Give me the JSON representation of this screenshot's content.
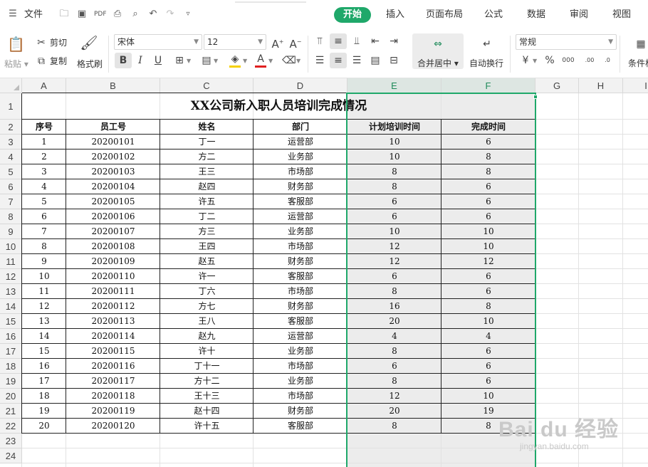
{
  "menu": {
    "file": "文件",
    "tabs": [
      "开始",
      "插入",
      "页面布局",
      "公式",
      "数据",
      "审阅",
      "视图"
    ]
  },
  "ribbon": {
    "paste": "粘贴",
    "cut": "剪切",
    "copy": "复制",
    "format_painter": "格式刷",
    "font_name": "宋体",
    "font_size": "12",
    "merge_center": "合并居中",
    "wrap_text": "自动换行",
    "number_format": "常规",
    "conditional_format": "条件格"
  },
  "sheet": {
    "columns": [
      "A",
      "B",
      "C",
      "D",
      "E",
      "F",
      "G",
      "H",
      "I"
    ],
    "title": "XX公司新入职人员培训完成情况",
    "headers": [
      "序号",
      "员工号",
      "姓名",
      "部门",
      "计划培训时间",
      "完成时间"
    ],
    "rows": [
      [
        "1",
        "20200101",
        "丁一",
        "运营部",
        "10",
        "6"
      ],
      [
        "2",
        "20200102",
        "方二",
        "业务部",
        "10",
        "8"
      ],
      [
        "3",
        "20200103",
        "王三",
        "市场部",
        "8",
        "8"
      ],
      [
        "4",
        "20200104",
        "赵四",
        "财务部",
        "8",
        "6"
      ],
      [
        "5",
        "20200105",
        "许五",
        "客服部",
        "6",
        "6"
      ],
      [
        "6",
        "20200106",
        "丁二",
        "运营部",
        "6",
        "6"
      ],
      [
        "7",
        "20200107",
        "方三",
        "业务部",
        "10",
        "10"
      ],
      [
        "8",
        "20200108",
        "王四",
        "市场部",
        "12",
        "10"
      ],
      [
        "9",
        "20200109",
        "赵五",
        "财务部",
        "12",
        "12"
      ],
      [
        "10",
        "20200110",
        "许一",
        "客服部",
        "6",
        "6"
      ],
      [
        "11",
        "20200111",
        "丁六",
        "市场部",
        "8",
        "6"
      ],
      [
        "12",
        "20200112",
        "方七",
        "财务部",
        "16",
        "8"
      ],
      [
        "13",
        "20200113",
        "王八",
        "客服部",
        "20",
        "10"
      ],
      [
        "14",
        "20200114",
        "赵九",
        "运营部",
        "4",
        "4"
      ],
      [
        "15",
        "20200115",
        "许十",
        "业务部",
        "8",
        "6"
      ],
      [
        "16",
        "20200116",
        "丁十一",
        "市场部",
        "6",
        "6"
      ],
      [
        "17",
        "20200117",
        "方十二",
        "业务部",
        "8",
        "6"
      ],
      [
        "18",
        "20200118",
        "王十三",
        "市场部",
        "12",
        "10"
      ],
      [
        "19",
        "20200119",
        "赵十四",
        "财务部",
        "20",
        "19"
      ],
      [
        "20",
        "20200120",
        "许十五",
        "客服部",
        "8",
        "8"
      ]
    ]
  },
  "watermark": {
    "brand": "Bai du 经验",
    "url": "jingyan.baidu.com"
  },
  "colors": {
    "accent": "#1fa86a",
    "selection_fill": "#ececec"
  }
}
